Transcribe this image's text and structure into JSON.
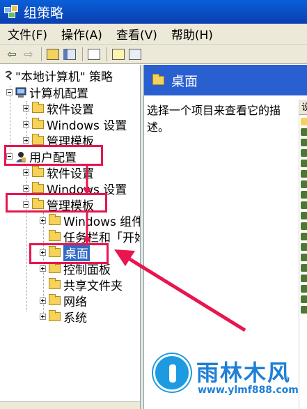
{
  "window": {
    "title": "组策略"
  },
  "menubar": {
    "items": [
      "文件(F)",
      "操作(A)",
      "查看(V)",
      "帮助(H)"
    ]
  },
  "toolbar": {
    "buttons": [
      "back-icon",
      "forward-icon",
      "up-folder-icon",
      "show-tree-icon",
      "export-list-icon",
      "help-icon",
      "properties-icon"
    ]
  },
  "tree": {
    "root": "\"本地计算机\" 策略",
    "computer_config": "计算机配置",
    "cc_software": "软件设置",
    "cc_windows": "Windows 设置",
    "cc_admin": "管理模板",
    "user_config": "用户配置",
    "uc_software": "软件设置",
    "uc_windows": "Windows 设置",
    "uc_admin": "管理模板",
    "uc_admin_windows": "Windows 组件",
    "uc_admin_taskbar": "任务栏和「开始」菜单",
    "uc_admin_desktop": "桌面",
    "uc_admin_control": "控制面板",
    "uc_admin_shared": "共享文件夹",
    "uc_admin_network": "网络",
    "uc_admin_system": "系统"
  },
  "details": {
    "header": "桌面",
    "description": "选择一个项目来查看它的描述。",
    "column_header": "设"
  },
  "watermark": {
    "title": "雨林木风",
    "url": "www.ylmf888.com"
  },
  "colors": {
    "title_bar": "#0a4fc8",
    "highlight_box": "#e8154f",
    "header_blue": "#2a5fd0",
    "watermark_blue": "#1e80d6"
  }
}
